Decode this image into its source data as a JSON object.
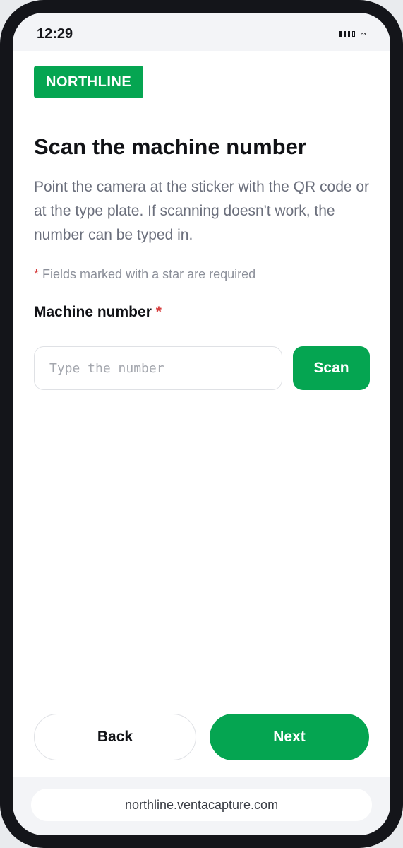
{
  "status_bar": {
    "time": "12:29"
  },
  "brand": {
    "name": "NORTHLINE",
    "color": "#05a551"
  },
  "page": {
    "title": "Scan the machine number",
    "description": "Point the camera at the sticker with the QR code or at the type plate. If scanning doesn't work, the number can be typed in.",
    "required_star": "*",
    "required_note": "Fields marked with a star are required"
  },
  "form": {
    "machine_number": {
      "label": "Machine number",
      "required_star": "*",
      "placeholder": "Type the number",
      "value": ""
    },
    "scan_label": "Scan"
  },
  "footer": {
    "back_label": "Back",
    "next_label": "Next"
  },
  "browser": {
    "url": "northline.ventacapture.com"
  },
  "colors": {
    "accent": "#05a551",
    "required": "#d63b3b"
  }
}
